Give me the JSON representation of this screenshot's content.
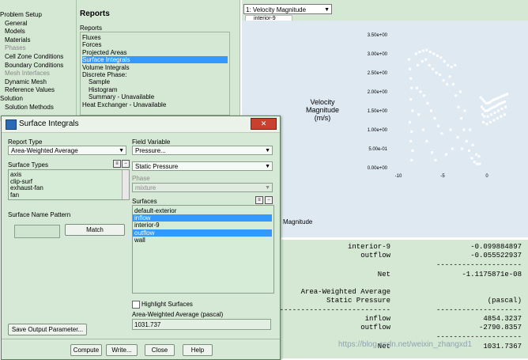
{
  "nav": {
    "items": [
      {
        "label": "Problem Setup",
        "header": true
      },
      {
        "label": "General"
      },
      {
        "label": "Models"
      },
      {
        "label": "Materials"
      },
      {
        "label": "Phases",
        "disabled": true
      },
      {
        "label": "Cell Zone Conditions"
      },
      {
        "label": "Boundary Conditions"
      },
      {
        "label": "Mesh Interfaces",
        "disabled": true
      },
      {
        "label": "Dynamic Mesh"
      },
      {
        "label": "Reference Values"
      },
      {
        "label": "Solution",
        "header": true
      },
      {
        "label": "Solution Methods"
      }
    ]
  },
  "reports": {
    "title": "Reports",
    "subtitle": "Reports",
    "items": [
      {
        "label": "Fluxes"
      },
      {
        "label": "Forces"
      },
      {
        "label": "Projected Areas"
      },
      {
        "label": "Surface Integrals",
        "selected": true
      },
      {
        "label": "Volume Integrals"
      },
      {
        "label": "Discrete Phase:"
      },
      {
        "label": "Sample",
        "indent": true
      },
      {
        "label": "Histogram",
        "indent": true
      },
      {
        "label": "Summary - Unavailable",
        "indent": true
      },
      {
        "label": "Heat Exchanger - Unavailable"
      }
    ]
  },
  "graphics": {
    "window_select": "1: Velocity Magnitude",
    "tab": "interior-9",
    "ylabel_lines": [
      "Velocity",
      "Magnitude",
      "(m/s)"
    ],
    "yticks": [
      "3.50e+00",
      "3.00e+00",
      "2.50e+00",
      "2.00e+00",
      "1.50e+00",
      "1.00e+00",
      "5.00e-01",
      "0.00e+00"
    ],
    "xticks": [
      "-10",
      "-5",
      "0"
    ],
    "footer_text": "Magnitude"
  },
  "chart_data": {
    "type": "scatter",
    "title": "",
    "xlabel": "",
    "ylabel": "Velocity Magnitude (m/s)",
    "xlim": [
      -10,
      0
    ],
    "ylim": [
      0,
      3.5
    ],
    "yticks": [
      3.5,
      3.0,
      2.5,
      2.0,
      1.5,
      1.0,
      0.5,
      0.0
    ],
    "xticks": [
      -10,
      -5,
      0
    ],
    "series": [
      {
        "color": "#ffffff",
        "points": [
          [
            -8.8,
            2.85
          ],
          [
            -8.7,
            2.6
          ],
          [
            -8.6,
            2.35
          ],
          [
            -8.5,
            2.1
          ],
          [
            -8.6,
            1.8
          ],
          [
            -8.4,
            1.5
          ],
          [
            -8.7,
            1.2
          ],
          [
            -8.5,
            0.95
          ],
          [
            -8.6,
            0.7
          ],
          [
            -8.4,
            0.45
          ],
          [
            -8.5,
            0.2
          ],
          [
            -8.0,
            3.0
          ],
          [
            -7.6,
            3.05
          ],
          [
            -7.2,
            3.08
          ],
          [
            -6.8,
            3.1
          ],
          [
            -6.4,
            3.05
          ],
          [
            -6.0,
            3.0
          ],
          [
            -5.6,
            2.95
          ],
          [
            -5.2,
            2.9
          ],
          [
            -4.8,
            2.8
          ],
          [
            -4.4,
            2.7
          ],
          [
            -4.0,
            2.65
          ],
          [
            -3.6,
            2.7
          ],
          [
            -7.8,
            2.7
          ],
          [
            -7.3,
            2.8
          ],
          [
            -6.9,
            2.85
          ],
          [
            -6.5,
            2.7
          ],
          [
            -6.1,
            2.6
          ],
          [
            -5.7,
            2.5
          ],
          [
            -5.3,
            2.45
          ],
          [
            -4.9,
            2.3
          ],
          [
            -4.5,
            2.2
          ],
          [
            -7.9,
            2.1
          ],
          [
            -7.5,
            2.0
          ],
          [
            -7.1,
            1.9
          ],
          [
            -6.7,
            1.7
          ],
          [
            -6.3,
            1.5
          ],
          [
            -5.9,
            1.3
          ],
          [
            -5.5,
            1.1
          ],
          [
            -5.1,
            0.9
          ],
          [
            -7.7,
            1.4
          ],
          [
            -7.2,
            1.0
          ],
          [
            -6.8,
            0.7
          ],
          [
            -6.2,
            0.4
          ],
          [
            -5.8,
            0.2
          ],
          [
            -4.6,
            0.35
          ],
          [
            -4.2,
            2.4
          ],
          [
            -3.8,
            2.2
          ],
          [
            -3.5,
            1.9
          ],
          [
            -3.2,
            1.6
          ],
          [
            -2.9,
            1.3
          ],
          [
            -2.6,
            1.0
          ],
          [
            -2.3,
            0.7
          ],
          [
            -2.0,
            0.45
          ],
          [
            -1.7,
            0.25
          ],
          [
            -1.4,
            0.15
          ],
          [
            -1.1,
            0.1
          ],
          [
            -0.8,
            0.1
          ],
          [
            -3.0,
            2.0
          ],
          [
            -2.5,
            1.5
          ],
          [
            -1.9,
            1.0
          ],
          [
            -1.6,
            0.6
          ],
          [
            -1.2,
            0.35
          ],
          [
            -0.9,
            0.3
          ],
          [
            -3.3,
            0.8
          ],
          [
            -2.8,
            0.5
          ],
          [
            -4.1,
            1.0
          ],
          [
            -3.9,
            0.5
          ],
          [
            -0.7,
            1.85
          ],
          [
            -0.5,
            1.8
          ],
          [
            -0.3,
            1.75
          ],
          [
            -0.1,
            1.7
          ],
          [
            0.1,
            1.7
          ],
          [
            0.3,
            1.72
          ],
          [
            0.5,
            1.75
          ],
          [
            0.7,
            1.78
          ],
          [
            0.9,
            1.8
          ],
          [
            1.1,
            1.82
          ],
          [
            1.3,
            1.84
          ],
          [
            1.5,
            1.86
          ],
          [
            1.7,
            1.88
          ],
          [
            1.9,
            1.9
          ],
          [
            2.1,
            1.92
          ],
          [
            2.3,
            1.94
          ],
          [
            -0.6,
            1.6
          ],
          [
            -0.4,
            1.55
          ],
          [
            -0.2,
            1.5
          ],
          [
            0.0,
            1.5
          ],
          [
            0.2,
            1.52
          ],
          [
            0.4,
            1.55
          ],
          [
            0.6,
            1.58
          ],
          [
            0.8,
            1.6
          ],
          [
            1.0,
            1.62
          ],
          [
            1.2,
            1.65
          ],
          [
            1.4,
            1.68
          ],
          [
            1.6,
            1.7
          ],
          [
            1.8,
            1.72
          ],
          [
            2.0,
            1.74
          ],
          [
            -0.5,
            1.4
          ],
          [
            -0.3,
            1.35
          ],
          [
            0.1,
            1.35
          ],
          [
            0.5,
            1.4
          ],
          [
            0.9,
            1.45
          ],
          [
            1.3,
            1.5
          ],
          [
            1.7,
            1.55
          ],
          [
            2.1,
            1.6
          ],
          [
            -0.4,
            1.2
          ],
          [
            0.0,
            1.15
          ],
          [
            0.4,
            1.2
          ],
          [
            0.8,
            1.25
          ],
          [
            1.2,
            1.3
          ],
          [
            1.6,
            1.35
          ],
          [
            2.0,
            1.4
          ]
        ]
      }
    ]
  },
  "console": {
    "rows": [
      {
        "label": "interior-9",
        "value": "-0.099884897"
      },
      {
        "label": "outflow",
        "value": "-0.055522937"
      },
      {
        "label": "",
        "value": "--------------------",
        "sep": true
      },
      {
        "label": "Net",
        "value": "-1.1175871e-08"
      },
      {
        "label": "Area-Weighted Average",
        "value": ""
      },
      {
        "label": "Static Pressure",
        "value": "(pascal)"
      },
      {
        "label": "--------------------------------",
        "value": "--------------------",
        "sep": true
      },
      {
        "label": "inflow",
        "value": "4854.3237"
      },
      {
        "label": "outflow",
        "value": "-2790.8357"
      },
      {
        "label": "",
        "value": "--------------------",
        "sep": true
      },
      {
        "label": "Net",
        "value": "1031.7367"
      }
    ],
    "watermark": "https://blog.csdn.net/weixin_zhangxd1"
  },
  "dialog": {
    "title": "Surface Integrals",
    "close_symbol": "✕",
    "report_type_label": "Report Type",
    "report_type_value": "Area-Weighted Average",
    "surface_types_label": "Surface Types",
    "surface_types": [
      "axis",
      "clip-surf",
      "exhaust-fan",
      "fan"
    ],
    "name_pattern_label": "Surface Name Pattern",
    "match_label": "Match",
    "field_variable_label": "Field Variable",
    "field_variable_value": "Pressure...",
    "field_sub_value": "Static Pressure",
    "phase_label": "Phase",
    "phase_value": "mixture",
    "surfaces_label": "Surfaces",
    "surfaces": [
      {
        "label": "default-exterior"
      },
      {
        "label": "inflow",
        "selected": true
      },
      {
        "label": "interior-9"
      },
      {
        "label": "outflow",
        "selected": true
      },
      {
        "label": "wall"
      }
    ],
    "highlight_label": "Highlight Surfaces",
    "result_label": "Area-Weighted Average (pascal)",
    "result_value": "1031.737",
    "save_param_label": "Save Output Parameter...",
    "buttons": {
      "compute": "Compute",
      "write": "Write...",
      "close": "Close",
      "help": "Help"
    }
  }
}
